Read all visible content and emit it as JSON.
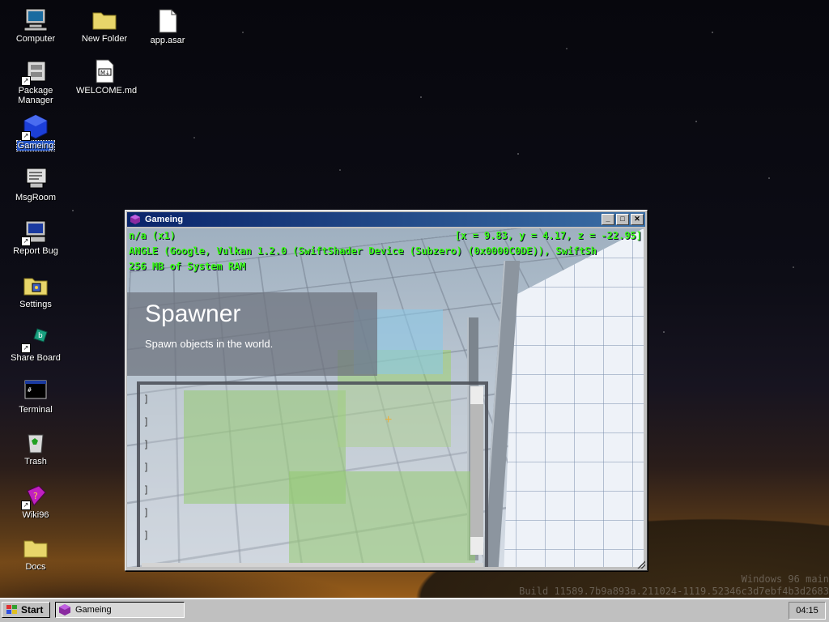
{
  "desktop": {
    "icons": [
      {
        "label": "Computer",
        "icon": "computer-icon"
      },
      {
        "label": "New Folder",
        "icon": "folder-icon"
      },
      {
        "label": "app.asar",
        "icon": "file-icon"
      },
      {
        "label": "Package Manager",
        "icon": "package-manager-icon"
      },
      {
        "label": "WELCOME.md",
        "icon": "markdown-file-icon"
      },
      {
        "label": "Gameing",
        "icon": "gameing-cube-icon"
      },
      {
        "label": "MsgRoom",
        "icon": "msgroom-icon"
      },
      {
        "label": "Report Bug",
        "icon": "report-bug-icon"
      },
      {
        "label": "Settings",
        "icon": "settings-icon"
      },
      {
        "label": "Share Board",
        "icon": "share-board-icon"
      },
      {
        "label": "Terminal",
        "icon": "terminal-icon"
      },
      {
        "label": "Trash",
        "icon": "trash-icon"
      },
      {
        "label": "Wiki96",
        "icon": "wiki-book-icon"
      },
      {
        "label": "Docs",
        "icon": "folder-icon"
      }
    ]
  },
  "window": {
    "title": "Gameing",
    "controls": {
      "minimize": "_",
      "maximize": "□",
      "close": "✕"
    },
    "hud": {
      "line1_left": "n/a (x1)",
      "line1_right": "[x = 9.83, y = 4.17, z = -22.95]",
      "line2": "ANGLE (Google, Vulkan 1.2.0 (SwiftShader Device (Subzero) (0x0000C0DE)), SwiftSh",
      "line3": "256 MB of System RAM"
    },
    "spawner": {
      "title": "Spawner",
      "subtitle": "Spawn objects in the world."
    },
    "console_lines": [
      "]",
      "]",
      "]",
      "]",
      "]",
      "]",
      "]"
    ]
  },
  "watermark": {
    "line1": "Windows 96 main",
    "line2": "Build 11589.7b9a893a.211024-1119.52346c3d7ebf4b3d2683"
  },
  "taskbar": {
    "start_label": "Start",
    "task_label": "Gameing",
    "clock": "04:15"
  },
  "colors": {
    "titlebar": "#0a246a",
    "hud_text": "#39ff14",
    "selection": "#2152c4"
  }
}
